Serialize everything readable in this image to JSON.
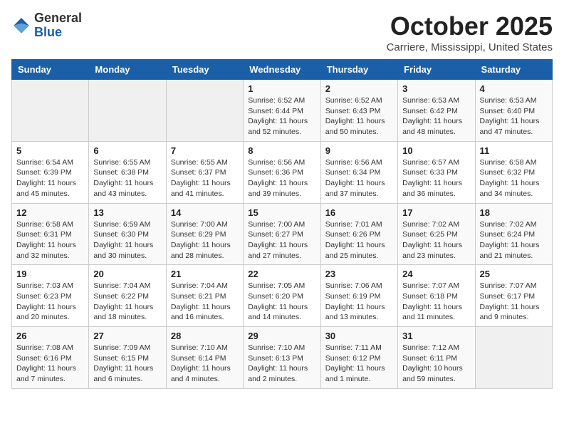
{
  "logo": {
    "general": "General",
    "blue": "Blue"
  },
  "title": "October 2025",
  "location": "Carriere, Mississippi, United States",
  "days_of_week": [
    "Sunday",
    "Monday",
    "Tuesday",
    "Wednesday",
    "Thursday",
    "Friday",
    "Saturday"
  ],
  "weeks": [
    [
      {
        "num": "",
        "info": ""
      },
      {
        "num": "",
        "info": ""
      },
      {
        "num": "",
        "info": ""
      },
      {
        "num": "1",
        "info": "Sunrise: 6:52 AM\nSunset: 6:44 PM\nDaylight: 11 hours\nand 52 minutes."
      },
      {
        "num": "2",
        "info": "Sunrise: 6:52 AM\nSunset: 6:43 PM\nDaylight: 11 hours\nand 50 minutes."
      },
      {
        "num": "3",
        "info": "Sunrise: 6:53 AM\nSunset: 6:42 PM\nDaylight: 11 hours\nand 48 minutes."
      },
      {
        "num": "4",
        "info": "Sunrise: 6:53 AM\nSunset: 6:40 PM\nDaylight: 11 hours\nand 47 minutes."
      }
    ],
    [
      {
        "num": "5",
        "info": "Sunrise: 6:54 AM\nSunset: 6:39 PM\nDaylight: 11 hours\nand 45 minutes."
      },
      {
        "num": "6",
        "info": "Sunrise: 6:55 AM\nSunset: 6:38 PM\nDaylight: 11 hours\nand 43 minutes."
      },
      {
        "num": "7",
        "info": "Sunrise: 6:55 AM\nSunset: 6:37 PM\nDaylight: 11 hours\nand 41 minutes."
      },
      {
        "num": "8",
        "info": "Sunrise: 6:56 AM\nSunset: 6:36 PM\nDaylight: 11 hours\nand 39 minutes."
      },
      {
        "num": "9",
        "info": "Sunrise: 6:56 AM\nSunset: 6:34 PM\nDaylight: 11 hours\nand 37 minutes."
      },
      {
        "num": "10",
        "info": "Sunrise: 6:57 AM\nSunset: 6:33 PM\nDaylight: 11 hours\nand 36 minutes."
      },
      {
        "num": "11",
        "info": "Sunrise: 6:58 AM\nSunset: 6:32 PM\nDaylight: 11 hours\nand 34 minutes."
      }
    ],
    [
      {
        "num": "12",
        "info": "Sunrise: 6:58 AM\nSunset: 6:31 PM\nDaylight: 11 hours\nand 32 minutes."
      },
      {
        "num": "13",
        "info": "Sunrise: 6:59 AM\nSunset: 6:30 PM\nDaylight: 11 hours\nand 30 minutes."
      },
      {
        "num": "14",
        "info": "Sunrise: 7:00 AM\nSunset: 6:29 PM\nDaylight: 11 hours\nand 28 minutes."
      },
      {
        "num": "15",
        "info": "Sunrise: 7:00 AM\nSunset: 6:27 PM\nDaylight: 11 hours\nand 27 minutes."
      },
      {
        "num": "16",
        "info": "Sunrise: 7:01 AM\nSunset: 6:26 PM\nDaylight: 11 hours\nand 25 minutes."
      },
      {
        "num": "17",
        "info": "Sunrise: 7:02 AM\nSunset: 6:25 PM\nDaylight: 11 hours\nand 23 minutes."
      },
      {
        "num": "18",
        "info": "Sunrise: 7:02 AM\nSunset: 6:24 PM\nDaylight: 11 hours\nand 21 minutes."
      }
    ],
    [
      {
        "num": "19",
        "info": "Sunrise: 7:03 AM\nSunset: 6:23 PM\nDaylight: 11 hours\nand 20 minutes."
      },
      {
        "num": "20",
        "info": "Sunrise: 7:04 AM\nSunset: 6:22 PM\nDaylight: 11 hours\nand 18 minutes."
      },
      {
        "num": "21",
        "info": "Sunrise: 7:04 AM\nSunset: 6:21 PM\nDaylight: 11 hours\nand 16 minutes."
      },
      {
        "num": "22",
        "info": "Sunrise: 7:05 AM\nSunset: 6:20 PM\nDaylight: 11 hours\nand 14 minutes."
      },
      {
        "num": "23",
        "info": "Sunrise: 7:06 AM\nSunset: 6:19 PM\nDaylight: 11 hours\nand 13 minutes."
      },
      {
        "num": "24",
        "info": "Sunrise: 7:07 AM\nSunset: 6:18 PM\nDaylight: 11 hours\nand 11 minutes."
      },
      {
        "num": "25",
        "info": "Sunrise: 7:07 AM\nSunset: 6:17 PM\nDaylight: 11 hours\nand 9 minutes."
      }
    ],
    [
      {
        "num": "26",
        "info": "Sunrise: 7:08 AM\nSunset: 6:16 PM\nDaylight: 11 hours\nand 7 minutes."
      },
      {
        "num": "27",
        "info": "Sunrise: 7:09 AM\nSunset: 6:15 PM\nDaylight: 11 hours\nand 6 minutes."
      },
      {
        "num": "28",
        "info": "Sunrise: 7:10 AM\nSunset: 6:14 PM\nDaylight: 11 hours\nand 4 minutes."
      },
      {
        "num": "29",
        "info": "Sunrise: 7:10 AM\nSunset: 6:13 PM\nDaylight: 11 hours\nand 2 minutes."
      },
      {
        "num": "30",
        "info": "Sunrise: 7:11 AM\nSunset: 6:12 PM\nDaylight: 11 hours\nand 1 minute."
      },
      {
        "num": "31",
        "info": "Sunrise: 7:12 AM\nSunset: 6:11 PM\nDaylight: 10 hours\nand 59 minutes."
      },
      {
        "num": "",
        "info": ""
      }
    ]
  ]
}
